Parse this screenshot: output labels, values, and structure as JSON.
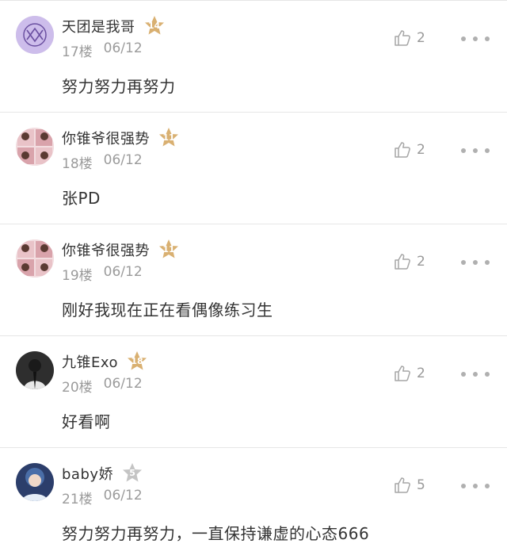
{
  "comments": [
    {
      "username": "天团是我哥",
      "level": "14",
      "badge_color": "#d9b071",
      "floor": "17楼",
      "date": "06/12",
      "text": "努力努力再努力",
      "likes": "2",
      "avatar_icon": "exo-logo-avatar",
      "avatar_color": "#c9b8e8"
    },
    {
      "username": "你锥爷很强势",
      "level": "11",
      "badge_color": "#d9b071",
      "floor": "18楼",
      "date": "06/12",
      "text": "张PD",
      "likes": "2",
      "avatar_icon": "photo-collage-avatar",
      "avatar_color": "#f1d9dc"
    },
    {
      "username": "你锥爷很强势",
      "level": "11",
      "badge_color": "#d9b071",
      "floor": "19楼",
      "date": "06/12",
      "text": "刚好我现在正在看偶像练习生",
      "likes": "2",
      "avatar_icon": "photo-collage-avatar",
      "avatar_color": "#f1d9dc"
    },
    {
      "username": "九锥Exo",
      "level": "18",
      "badge_color": "#d9b071",
      "floor": "20楼",
      "date": "06/12",
      "text": "好看啊",
      "likes": "2",
      "avatar_icon": "dark-photo-avatar",
      "avatar_color": "#3b3b3b"
    },
    {
      "username": "baby娇",
      "level": "5",
      "badge_color": "#c4c4c4",
      "floor": "21楼",
      "date": "06/12",
      "text": "努力努力再努力，一直保持谦虚的心态666",
      "likes": "5",
      "avatar_icon": "portrait-photo-avatar",
      "avatar_color": "#2c3e6b"
    }
  ],
  "icons": {
    "like": "thumbs-up-icon",
    "more": "more-dots-icon",
    "badge": "star-badge-icon"
  }
}
